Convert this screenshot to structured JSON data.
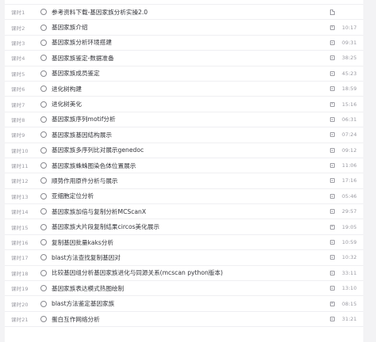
{
  "lessons": [
    {
      "no": "课时1",
      "title": "参考资料下载-基因家族分析实操2.0",
      "duration": "",
      "type": "doc-icon"
    },
    {
      "no": "课时2",
      "title": "基因家族介绍",
      "duration": "10:17",
      "type": "video-icon"
    },
    {
      "no": "课时3",
      "title": "基因家族分析环境搭建",
      "duration": "09:31",
      "type": "video-icon"
    },
    {
      "no": "课时4",
      "title": "基因家族鉴定-数据准备",
      "duration": "38:25",
      "type": "video-icon"
    },
    {
      "no": "课时5",
      "title": "基因家族成员鉴定",
      "duration": "45:23",
      "type": "video-icon"
    },
    {
      "no": "课时6",
      "title": "进化树构建",
      "duration": "18:59",
      "type": "video-icon"
    },
    {
      "no": "课时7",
      "title": "进化树美化",
      "duration": "15:16",
      "type": "video-icon"
    },
    {
      "no": "课时8",
      "title": "基因家族序列motif分析",
      "duration": "06:31",
      "type": "video-icon"
    },
    {
      "no": "课时9",
      "title": "基因家族基因结构展示",
      "duration": "07:24",
      "type": "video-icon"
    },
    {
      "no": "课时10",
      "title": "基因家族多序列比对展示genedoc",
      "duration": "09:12",
      "type": "video-icon"
    },
    {
      "no": "课时11",
      "title": "基因家族蛛蛛图染色体位置展示",
      "duration": "11:06",
      "type": "video-icon"
    },
    {
      "no": "课时12",
      "title": "顺势作用原件分析与展示",
      "duration": "17:16",
      "type": "video-icon"
    },
    {
      "no": "课时13",
      "title": "亚细胞定位分析",
      "duration": "05:46",
      "type": "video-icon"
    },
    {
      "no": "课时14",
      "title": "基因家族加倍与复制分析MCScanX",
      "duration": "29:57",
      "type": "video-icon"
    },
    {
      "no": "课时15",
      "title": "基因家族大片段复制结果circos美化展示",
      "duration": "19:05",
      "type": "video-icon"
    },
    {
      "no": "课时16",
      "title": "复制基因批量kaks分析",
      "duration": "10:59",
      "type": "video-icon"
    },
    {
      "no": "课时17",
      "title": "blast方法查找复制基因对",
      "duration": "10:32",
      "type": "video-icon"
    },
    {
      "no": "课时18",
      "title": "比较基因组分析基因家族进化与同源关系(mcscan python版本)",
      "duration": "33:11",
      "type": "video-icon"
    },
    {
      "no": "课时19",
      "title": "基因家族表达模式热图绘制",
      "duration": "13:10",
      "type": "video-icon"
    },
    {
      "no": "课时20",
      "title": "blast方法鉴定基因家族",
      "duration": "08:15",
      "type": "video-icon"
    },
    {
      "no": "课时21",
      "title": "蛋白互作网络分析",
      "duration": "31:21",
      "type": "video-icon"
    }
  ]
}
